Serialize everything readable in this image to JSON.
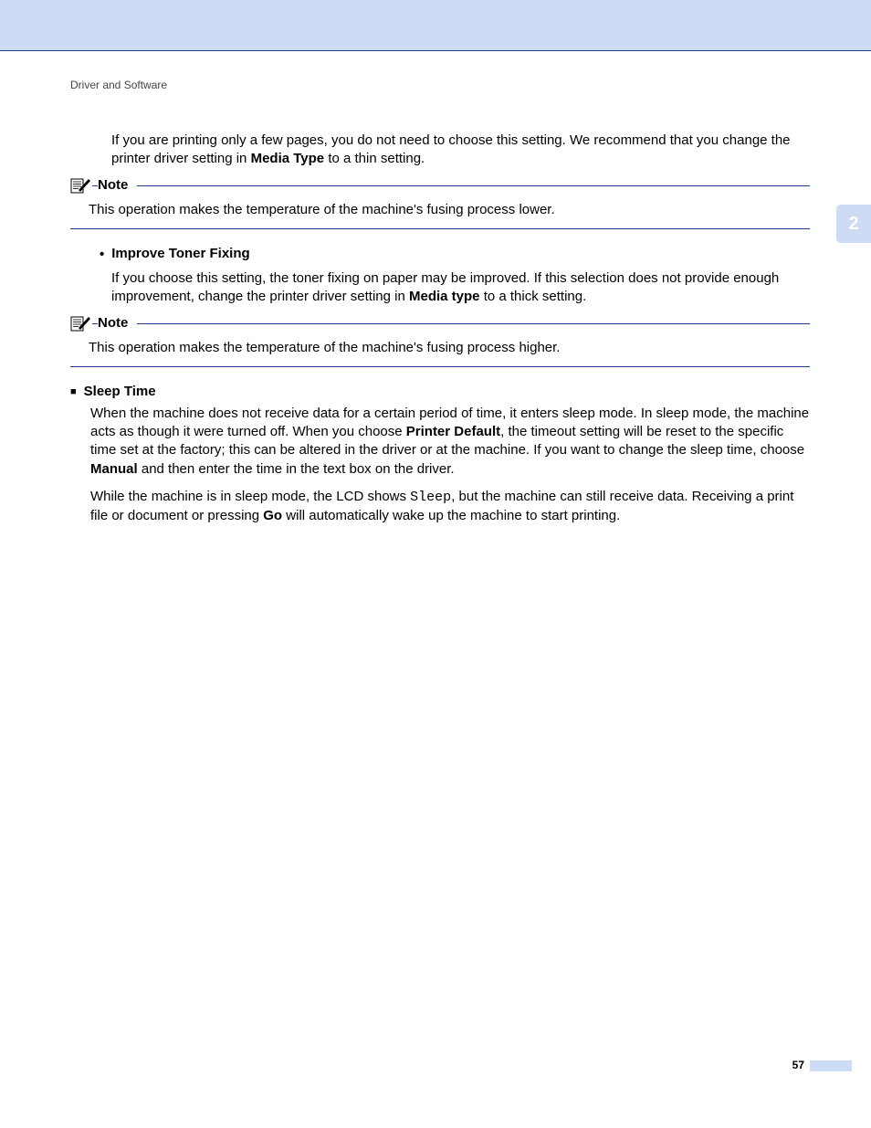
{
  "runningHead": "Driver and Software",
  "chapterTab": "2",
  "pageNumber": "57",
  "intro": {
    "t1": "If you are printing only a few pages, you do not need to choose this setting. We recommend that you change the printer driver setting in ",
    "b1": "Media Type",
    "t2": " to a thin setting."
  },
  "note1": {
    "label": "Note",
    "body": "This operation makes the temperature of the machine's fusing process lower."
  },
  "improve": {
    "heading": "Improve Toner Fixing",
    "t1": "If you choose this setting, the toner fixing on paper may be improved. If this selection does not provide enough improvement, change the printer driver setting in ",
    "b1": "Media type",
    "t2": " to a thick setting."
  },
  "note2": {
    "label": "Note",
    "body": "This operation makes the temperature of the machine's fusing process higher."
  },
  "sleep": {
    "heading": "Sleep Time",
    "p1a": "When the machine does not receive data for a certain period of time, it enters sleep mode. In sleep mode, the machine acts as though it were turned off. When you choose ",
    "p1b": "Printer Default",
    "p1c": ", the timeout setting will be reset to the specific time set at the factory; this can be altered in the driver or at the machine. If you want to change the sleep time, choose ",
    "p1d": "Manual",
    "p1e": " and then enter the time in the text box on the driver.",
    "p2a": "While the machine is in sleep mode, the LCD shows ",
    "p2b": "Sleep",
    "p2c": ", but the machine can still receive data. Receiving a print file or document or pressing ",
    "p2d": "Go",
    "p2e": " will automatically wake up the machine to start printing."
  }
}
